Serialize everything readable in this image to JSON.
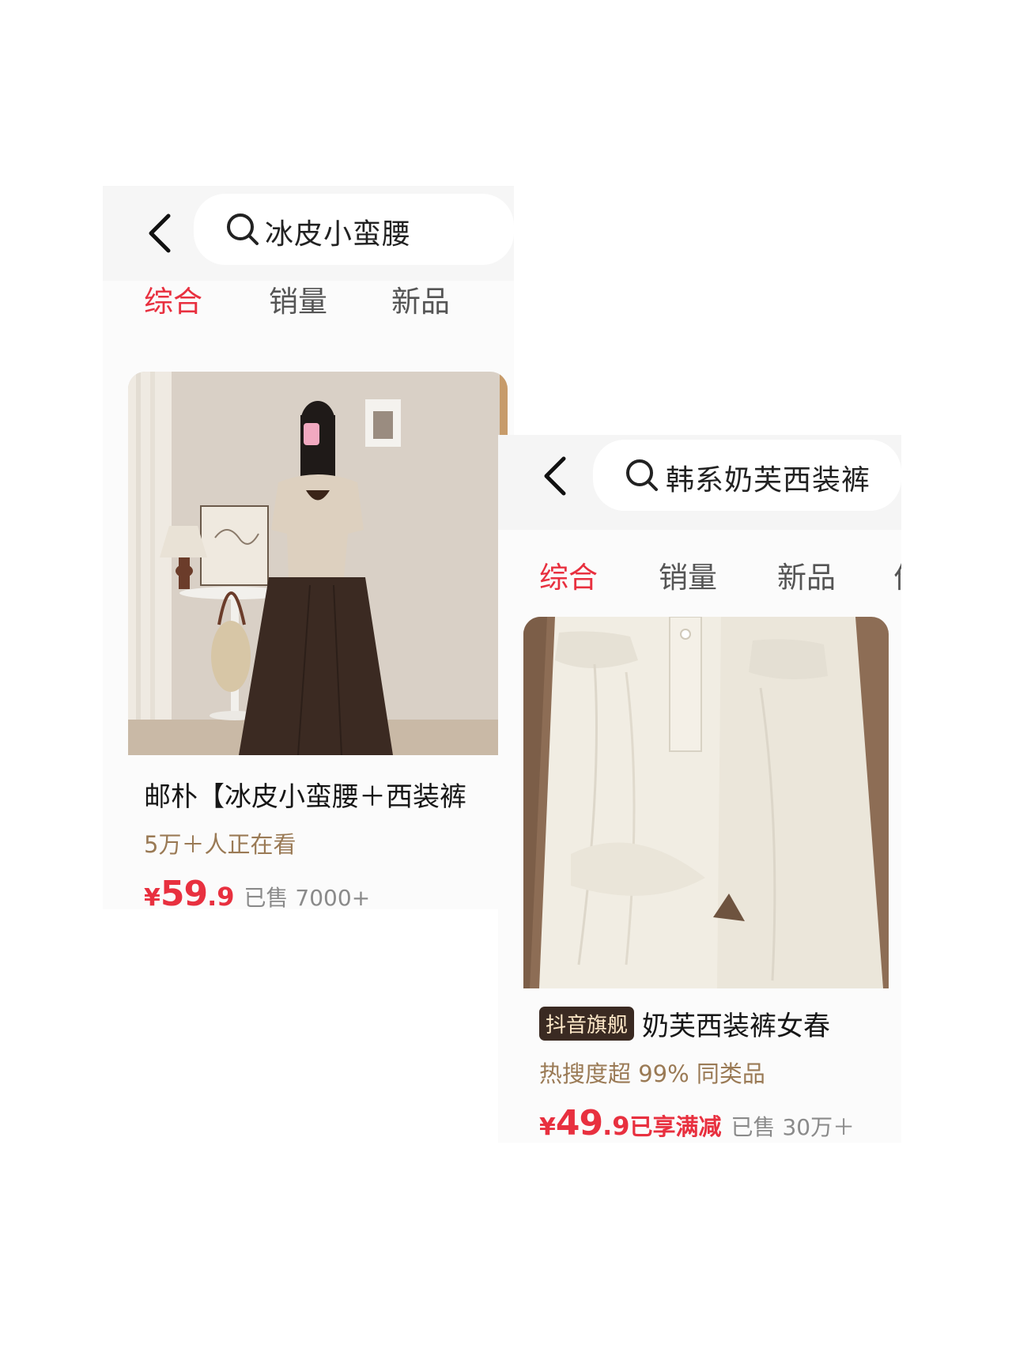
{
  "screen1": {
    "search": {
      "query": "冰皮小蛮腰"
    },
    "tabs": [
      "综合",
      "销量",
      "新品"
    ],
    "product": {
      "title": "邮朴【冰皮小蛮腰＋西装裤",
      "subtitle": "5万＋人正在看",
      "price": {
        "currency": "¥",
        "integer": "59",
        "decimal": ".9"
      },
      "sold": "已售 7000+"
    }
  },
  "screen2": {
    "search": {
      "query": "韩系奶芙西装裤"
    },
    "tabs": [
      "综合",
      "销量",
      "新品",
      "价"
    ],
    "product": {
      "shop_tag": "抖音旗舰",
      "title": "奶芙西装裤女春",
      "subtitle": "热搜度超 99% 同类品",
      "price": {
        "currency": "¥",
        "integer": "49",
        "decimal": ".9"
      },
      "promo": "已享满减",
      "sold": "已售 30万＋"
    }
  },
  "colors": {
    "accent": "#e8303f",
    "subtitle": "#9a7a55",
    "shop_tag_bg": "#3a2a22"
  }
}
